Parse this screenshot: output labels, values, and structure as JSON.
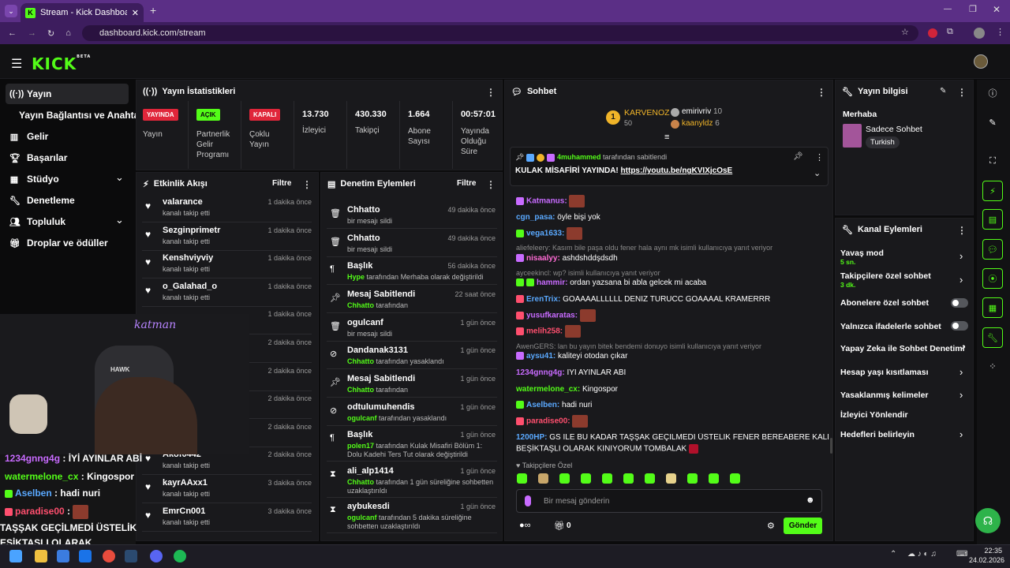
{
  "browser": {
    "tab_title": "Stream - Kick Dashboard",
    "url": "dashboard.kick.com/stream"
  },
  "brand": {
    "logo": "KICK",
    "beta": "BETA",
    "accent": "#53fc18"
  },
  "sidebar": {
    "items": [
      {
        "label": "Yayın",
        "icon": "broadcast-icon"
      },
      {
        "label": "Yayın Bağlantısı ve Anahtarı",
        "icon": ""
      },
      {
        "label": "Gelir",
        "icon": "chart-icon"
      },
      {
        "label": "Başarılar",
        "icon": "trophy-icon"
      },
      {
        "label": "Stüdyo",
        "icon": "grid-icon"
      },
      {
        "label": "Denetleme",
        "icon": "wrench-icon"
      },
      {
        "label": "Topluluk",
        "icon": "people-icon"
      },
      {
        "label": "Droplar ve ödüller",
        "icon": "gift-icon"
      }
    ]
  },
  "stats": {
    "title": "Yayın İstatistikleri",
    "live_badge": "YAYINDA",
    "live_label": "Yayın",
    "partner_badge": "AÇIK",
    "partner_label1": "Partnerlik",
    "partner_label2": "Gelir",
    "partner_label3": "Programı",
    "multi_badge": "KAPALI",
    "multi_label1": "Çoklu",
    "multi_label2": "Yayın",
    "viewers": "13.730",
    "viewers_label": "İzleyici",
    "followers": "430.330",
    "followers_label": "Takipçi",
    "subs": "1.664",
    "subs_label1": "Abone",
    "subs_label2": "Sayısı",
    "uptime": "00:57:01",
    "uptime_label1": "Yayında",
    "uptime_label2": "Olduğu",
    "uptime_label3": "Süre"
  },
  "activity": {
    "title": "Etkinlik Akışı",
    "filter": "Filtre",
    "rows": [
      {
        "name": "valarance",
        "sub": "kanalı takip etti",
        "time": "1 dakika önce"
      },
      {
        "name": "Sezginprimetr",
        "sub": "kanalı takip etti",
        "time": "1 dakika önce"
      },
      {
        "name": "Kenshviyviy",
        "sub": "kanalı takip etti",
        "time": "1 dakika önce"
      },
      {
        "name": "o_Galahad_o",
        "sub": "kanalı takip etti",
        "time": "1 dakika önce"
      },
      {
        "name": "",
        "sub": "",
        "time": "1 dakika önce"
      },
      {
        "name": "",
        "sub": "",
        "time": "2 dakika önce"
      },
      {
        "name": "",
        "sub": "",
        "time": "2 dakika önce"
      },
      {
        "name": "",
        "sub": "",
        "time": "2 dakika önce"
      },
      {
        "name": "",
        "sub": "",
        "time": "2 dakika önce"
      },
      {
        "name": "Akof0442",
        "sub": "kanalı takip etti",
        "time": "2 dakika önce"
      },
      {
        "name": "kayrAAxx1",
        "sub": "kanalı takip etti",
        "time": "3 dakika önce"
      },
      {
        "name": "EmrCn001",
        "sub": "kanalı takip etti",
        "time": "3 dakika önce"
      }
    ]
  },
  "moderation": {
    "title": "Denetim Eylemleri",
    "filter": "Filtre",
    "rows": [
      {
        "name": "Chhatto",
        "sub_a": "",
        "sub_b": "bir mesajı sildi",
        "time": "49 dakika önce"
      },
      {
        "name": "Chhatto",
        "sub_a": "",
        "sub_b": "bir mesajı sildi",
        "time": "49 dakika önce"
      },
      {
        "name": "Başlık",
        "sub_a": "Hype",
        "sub_b": "tarafından Merhaba olarak değiştirildi",
        "time": "56 dakika önce"
      },
      {
        "name": "Mesaj Sabitlendi",
        "sub_a": "Chhatto",
        "sub_b": "tarafından",
        "time": "22 saat önce"
      },
      {
        "name": "ogulcanf",
        "sub_a": "",
        "sub_b": "bir mesajı sildi",
        "time": "1 gün önce"
      },
      {
        "name": "Dandanak3131",
        "sub_a": "Chhatto",
        "sub_b": "tarafından yasaklandı",
        "time": "1 gün önce"
      },
      {
        "name": "Mesaj Sabitlendi",
        "sub_a": "Chhatto",
        "sub_b": "tarafından",
        "time": "1 gün önce"
      },
      {
        "name": "odtulumuhendis",
        "sub_a": "ogulcanf",
        "sub_b": "tarafından yasaklandı",
        "time": "1 gün önce"
      },
      {
        "name": "Başlık",
        "sub_a": "polen17",
        "sub_b": "tarafından Kulak Misafiri Bölüm 1: Dolu Kadehi Ters Tut olarak değiştirildi",
        "time": "1 gün önce"
      },
      {
        "name": "ali_alp1414",
        "sub_a": "Chhatto",
        "sub_b": "tarafından 1 gün süreliğine sohbetten uzaklaştırıldı",
        "time": "1 gün önce"
      },
      {
        "name": "aybukesdi",
        "sub_a": "ogulcanf",
        "sub_b": "tarafından 5 dakika süreliğine sohbetten uzaklaştırıldı",
        "time": "1 gün önce"
      }
    ]
  },
  "chat": {
    "title": "Sohbet",
    "leader1": "KARVENOZ",
    "leader1_pts": "50",
    "leader2": "emirivriv",
    "leader2_pts": "10",
    "leader3": "kaanyldz",
    "leader3_pts": "6",
    "pinned_by": "4muhammed",
    "pinned_by_text": "tarafından sabitlendi",
    "pinned_text": "KULAK MİSAFİRİ YAYINDA!",
    "pinned_link": "https://youtu.be/ngKVIXjcOsE",
    "messages": [
      {
        "user": "Katmanus:",
        "color": "#c86bff",
        "text": ""
      },
      {
        "user": "cgn_pasa:",
        "color": "#5aa9ff",
        "text": "öyle bişi yok"
      },
      {
        "user": "vega1633:",
        "color": "#5aa9ff",
        "text": ""
      },
      {
        "user": "nisaalyy:",
        "color": "#ff6bd5",
        "text": "ashdshddşdsdh"
      },
      {
        "user": "hammir:",
        "color": "#c86bff",
        "text": "ordan yazsana bi abla gelcek mi acaba"
      },
      {
        "user": "ErenTrix:",
        "color": "#5aa9ff",
        "text": "GOAAAALLLLLL DENIZ TURUCC GOAAAAL KRAMERRR"
      },
      {
        "user": "yusufkaratas:",
        "color": "#c86bff",
        "text": ""
      },
      {
        "user": "melih258:",
        "color": "#ff4f6e",
        "text": ""
      },
      {
        "user": "aysu41:",
        "color": "#5aa9ff",
        "text": "kaliteyi otodan çıkar"
      },
      {
        "user": "1234gnng4g:",
        "color": "#c86bff",
        "text": "İYİ AYINLAR ABİ"
      },
      {
        "user": "watermelone_cx:",
        "color": "#53fc18",
        "text": "Kingospor"
      },
      {
        "user": "Aselben:",
        "color": "#5aa9ff",
        "text": "hadi nuri"
      },
      {
        "user": "paradise00:",
        "color": "#ff4f6e",
        "text": ""
      },
      {
        "user": "1200HP:",
        "color": "#5aa9ff",
        "text": "GS İLE BU KADAR TAŞŞAK GEÇİLMEDİ ÜSTELİK FENER BEREABERE KALDI"
      }
    ],
    "msg_cont": "BEŞİKTAŞLI OLARAK KINIYORUM TOMBALAK",
    "reply1": "aliefeleery: Kasım bile paşa oldu fener hala aynı mk isimli kullanıcıya yanıt veriyor",
    "reply2": "ayceekincl: wp? isimli kullanıcıya yanıt veriyor",
    "reply3": "AwenGERS: lan bu yayın bitek bendemi donuyo isimli kullanıcıya yanıt veriyor",
    "follower_only": "Takipçilere Özel",
    "placeholder": "Bir mesaj gönderin",
    "count": "0",
    "send": "Gönder"
  },
  "stream_info": {
    "title": "Yayın bilgisi",
    "stream_title": "Merhaba",
    "category": "Sadece Sohbet",
    "tag": "Turkish"
  },
  "channel_actions": {
    "title": "Kanal Eylemleri",
    "slow": "Yavaş mod",
    "slow_val": "5 sn.",
    "followers": "Takipçilere özel sohbet",
    "followers_val": "3 dk.",
    "subs": "Abonelere özel sohbet",
    "emotes": "Yalnızca ifadelerle sohbet",
    "ai": "Yapay Zeka ile Sohbet Denetimi",
    "age": "Hesap yaşı kısıtlaması",
    "banned": "Yasaklanmış kelimeler",
    "redirect": "İzleyici Yönlendir",
    "goals": "Hedefleri belirleyin"
  },
  "overlay": {
    "caption": "katman",
    "lines": [
      {
        "user": "1234gnng4g",
        "text": "İYİ AYINLAR ABİ"
      },
      {
        "user": "watermelone_cx",
        "text": "Kingospor"
      },
      {
        "user": "Aselben",
        "text": "hadi nuri"
      },
      {
        "user": "paradise00",
        "text": ""
      }
    ],
    "big1": "TAŞŞAK GEÇİLMEDİ ÜSTELİK",
    "big2": "EŞİKTAŞLI OLARAK",
    "brand": "HAWK"
  },
  "taskbar": {
    "time": "22:35",
    "date": "24.02.2026"
  }
}
